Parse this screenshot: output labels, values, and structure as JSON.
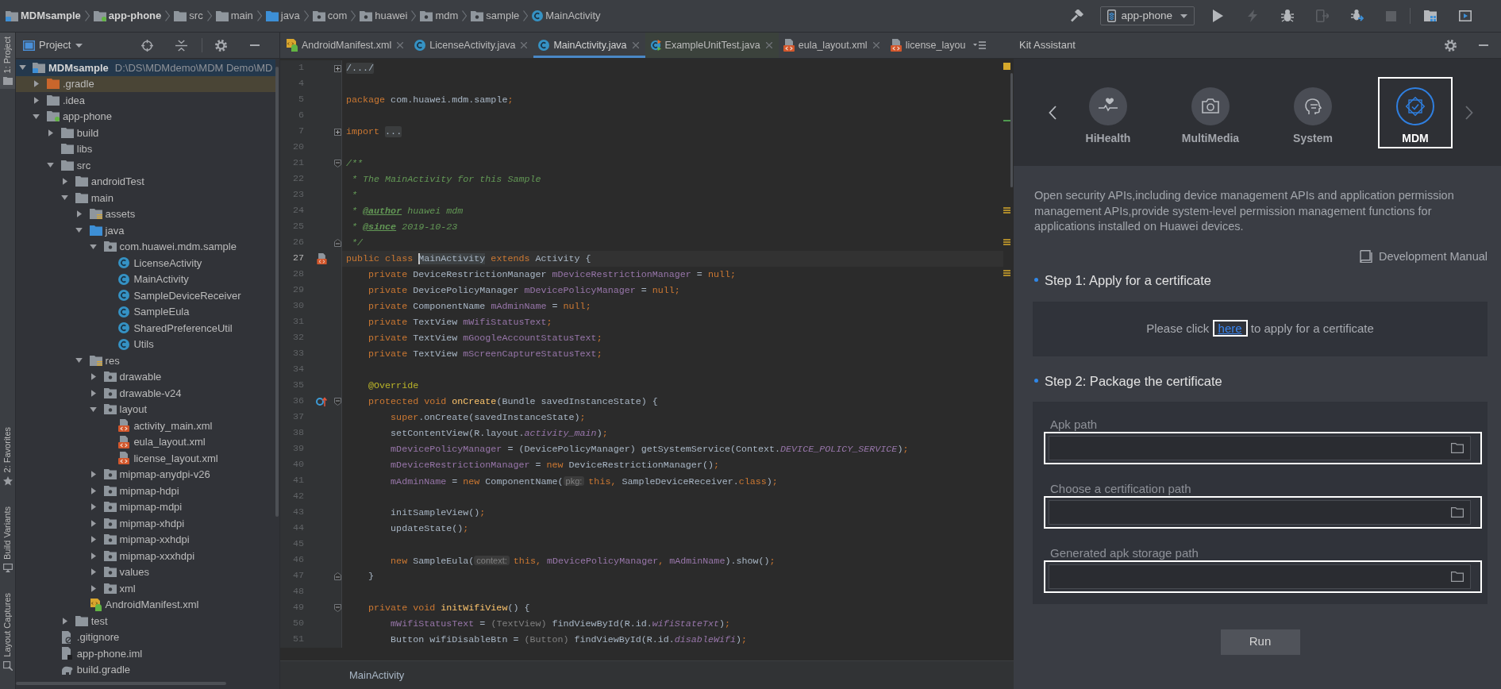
{
  "breadcrumb": [
    {
      "label": "MDMsample",
      "kind": "project_module"
    },
    {
      "label": "app-phone",
      "kind": "app_module"
    },
    {
      "label": "src",
      "kind": "folder"
    },
    {
      "label": "main",
      "kind": "folder"
    },
    {
      "label": "java",
      "kind": "source_folder"
    },
    {
      "label": "com",
      "kind": "package"
    },
    {
      "label": "huawei",
      "kind": "package"
    },
    {
      "label": "mdm",
      "kind": "package"
    },
    {
      "label": "sample",
      "kind": "package"
    },
    {
      "label": "MainActivity",
      "kind": "class"
    }
  ],
  "toolbar": [
    {
      "kind": "build",
      "disabled": false
    },
    {
      "kind": "run_config",
      "label": "app-phone"
    },
    {
      "kind": "run",
      "disabled": false
    },
    {
      "kind": "apply",
      "disabled": true
    },
    {
      "kind": "debug",
      "disabled": false
    },
    {
      "kind": "profile",
      "disabled": true
    },
    {
      "kind": "attach",
      "disabled": false
    },
    {
      "kind": "stop",
      "disabled": true
    },
    {
      "kind": "structure",
      "disabled": false
    },
    {
      "kind": "device",
      "disabled": false
    }
  ],
  "tool_stripe": [
    {
      "label": "1: Project",
      "kind": "project",
      "selected": true
    },
    {
      "label": "2: Favorites",
      "kind": "favorites",
      "selected": false
    },
    {
      "label": "Build Variants",
      "kind": "variants",
      "selected": false
    },
    {
      "label": "Layout Captures",
      "kind": "captures",
      "selected": false
    }
  ],
  "project_panel": {
    "view": "Project",
    "tree": [
      {
        "label": "MDMsample",
        "detail": "D:\\DS\\MDMdemo\\MDM Demo\\MD",
        "kind": "project_module",
        "expanded": true,
        "selected": true,
        "children": [
          {
            "label": ".gradle",
            "kind": "excluded_folder",
            "expanded": false,
            "selected": false
          },
          {
            "label": ".idea",
            "kind": "folder",
            "expanded": false,
            "selected": false
          },
          {
            "label": "app-phone",
            "kind": "app_module",
            "expanded": true,
            "selected": false,
            "children": [
              {
                "label": "build",
                "kind": "folder",
                "expanded": false,
                "selected": false
              },
              {
                "label": "libs",
                "kind": "folder",
                "selected": false
              },
              {
                "label": "src",
                "kind": "folder",
                "expanded": true,
                "selected": false,
                "children": [
                  {
                    "label": "androidTest",
                    "kind": "folder",
                    "expanded": false,
                    "selected": false
                  },
                  {
                    "label": "main",
                    "kind": "folder",
                    "expanded": true,
                    "selected": false,
                    "children": [
                      {
                        "label": "assets",
                        "kind": "resource_folder",
                        "expanded": false,
                        "selected": false
                      },
                      {
                        "label": "java",
                        "kind": "source_folder",
                        "expanded": true,
                        "selected": false,
                        "children": [
                          {
                            "label": "com.huawei.mdm.sample",
                            "kind": "package",
                            "expanded": true,
                            "selected": false,
                            "children": [
                              {
                                "label": "LicenseActivity",
                                "kind": "class",
                                "selected": false
                              },
                              {
                                "label": "MainActivity",
                                "kind": "class",
                                "selected": false
                              },
                              {
                                "label": "SampleDeviceReceiver",
                                "kind": "class",
                                "selected": false
                              },
                              {
                                "label": "SampleEula",
                                "kind": "class",
                                "selected": false
                              },
                              {
                                "label": "SharedPreferenceUtil",
                                "kind": "class",
                                "selected": false
                              },
                              {
                                "label": "Utils",
                                "kind": "class",
                                "selected": false
                              }
                            ]
                          }
                        ]
                      },
                      {
                        "label": "res",
                        "kind": "resource_folder",
                        "expanded": true,
                        "selected": false,
                        "children": [
                          {
                            "label": "drawable",
                            "kind": "package",
                            "expanded": false,
                            "selected": false
                          },
                          {
                            "label": "drawable-v24",
                            "kind": "package",
                            "expanded": false,
                            "selected": false
                          },
                          {
                            "label": "layout",
                            "kind": "package",
                            "expanded": true,
                            "selected": false,
                            "children": [
                              {
                                "label": "activity_main.xml",
                                "kind": "layout",
                                "selected": false
                              },
                              {
                                "label": "eula_layout.xml",
                                "kind": "layout",
                                "selected": false
                              },
                              {
                                "label": "license_layout.xml",
                                "kind": "layout",
                                "selected": false
                              }
                            ]
                          },
                          {
                            "label": "mipmap-anydpi-v26",
                            "kind": "package",
                            "expanded": false,
                            "selected": false
                          },
                          {
                            "label": "mipmap-hdpi",
                            "kind": "package",
                            "expanded": false,
                            "selected": false
                          },
                          {
                            "label": "mipmap-mdpi",
                            "kind": "package",
                            "expanded": false,
                            "selected": false
                          },
                          {
                            "label": "mipmap-xhdpi",
                            "kind": "package",
                            "expanded": false,
                            "selected": false
                          },
                          {
                            "label": "mipmap-xxhdpi",
                            "kind": "package",
                            "expanded": false,
                            "selected": false
                          },
                          {
                            "label": "mipmap-xxxhdpi",
                            "kind": "package",
                            "expanded": false,
                            "selected": false
                          },
                          {
                            "label": "values",
                            "kind": "package",
                            "expanded": false,
                            "selected": false
                          },
                          {
                            "label": "xml",
                            "kind": "package",
                            "expanded": false,
                            "selected": false
                          }
                        ]
                      },
                      {
                        "label": "AndroidManifest.xml",
                        "kind": "manifest",
                        "selected": false
                      }
                    ]
                  },
                  {
                    "label": "test",
                    "kind": "folder",
                    "expanded": false,
                    "selected": false
                  }
                ]
              },
              {
                "label": ".gitignore",
                "kind": "ignore_file",
                "selected": false
              },
              {
                "label": "app-phone.iml",
                "kind": "iml_file",
                "selected": false
              },
              {
                "label": "build.gradle",
                "kind": "gradle_file",
                "selected": false
              }
            ]
          }
        ]
      }
    ]
  },
  "editor": {
    "tabs": [
      {
        "label": "AndroidManifest.xml",
        "kind": "manifest",
        "selected": false,
        "closable": true
      },
      {
        "label": "LicenseActivity.java",
        "kind": "class",
        "selected": false,
        "closable": true
      },
      {
        "label": "MainActivity.java",
        "kind": "class",
        "selected": true,
        "closable": true
      },
      {
        "label": "ExampleUnitTest.java",
        "kind": "test_class",
        "selected": false,
        "closable": true
      },
      {
        "label": "eula_layout.xml",
        "kind": "layout",
        "selected": false,
        "closable": true
      },
      {
        "label": "license_layou",
        "kind": "layout",
        "selected": false,
        "closable": false
      }
    ],
    "lines": [
      {
        "number": "1",
        "fold": {
          "kind": "collapsed"
        },
        "current": false,
        "tokens": [
          {
            "text": "/.../",
            "kind": "fold"
          }
        ]
      },
      {
        "number": "4",
        "current": false
      },
      {
        "number": "5",
        "current": false,
        "tokens": [
          {
            "text": "package",
            "kind": "kw"
          },
          {
            "text": " com.huawei.mdm.sample",
            "kind": "plain"
          },
          {
            "text": ";",
            "kind": "punct"
          }
        ]
      },
      {
        "number": "6",
        "current": false
      },
      {
        "number": "7",
        "fold": {
          "kind": "collapsed"
        },
        "current": false,
        "tokens": [
          {
            "text": "import ",
            "kind": "kw"
          },
          {
            "text": "...",
            "kind": "fold"
          }
        ]
      },
      {
        "number": "20",
        "current": false
      },
      {
        "number": "21",
        "fold": {
          "kind": "start"
        },
        "current": false,
        "tokens": [
          {
            "text": "/**",
            "kind": "doc"
          }
        ]
      },
      {
        "number": "22",
        "current": false,
        "tokens": [
          {
            "text": " * The MainActivity for this Sample",
            "kind": "doc"
          }
        ]
      },
      {
        "number": "23",
        "current": false,
        "tokens": [
          {
            "text": " *",
            "kind": "doc"
          }
        ]
      },
      {
        "number": "24",
        "current": false,
        "tokens": [
          {
            "text": " * ",
            "kind": "doc"
          },
          {
            "text": "@author",
            "kind": "doctag"
          },
          {
            "text": " huawei mdm",
            "kind": "doc"
          }
        ]
      },
      {
        "number": "25",
        "current": false,
        "tokens": [
          {
            "text": " * ",
            "kind": "doc"
          },
          {
            "text": "@since",
            "kind": "doctag"
          },
          {
            "text": " 2019-10-23",
            "kind": "doc"
          }
        ]
      },
      {
        "number": "26",
        "fold": {
          "kind": "end"
        },
        "current": false,
        "tokens": [
          {
            "text": " */",
            "kind": "doc"
          }
        ]
      },
      {
        "number": "27",
        "gutter": {
          "kind": "layout"
        },
        "current": true,
        "tokens": [
          {
            "text": "public class ",
            "kind": "kw"
          },
          {
            "text": "MainActivity",
            "kind": "caret"
          },
          {
            "text": " extends ",
            "kind": "kw"
          },
          {
            "text": "Activity {",
            "kind": "plain"
          }
        ]
      },
      {
        "number": "28",
        "current": false,
        "tokens": [
          {
            "text": "    private ",
            "kind": "kw"
          },
          {
            "text": "DeviceRestrictionManager ",
            "kind": "plain"
          },
          {
            "text": "mDeviceRestrictionManager",
            "kind": "field"
          },
          {
            "text": " = ",
            "kind": "plain"
          },
          {
            "text": "null",
            "kind": "kw"
          },
          {
            "text": ";",
            "kind": "punct"
          }
        ]
      },
      {
        "number": "29",
        "current": false,
        "tokens": [
          {
            "text": "    private ",
            "kind": "kw"
          },
          {
            "text": "DevicePolicyManager ",
            "kind": "plain"
          },
          {
            "text": "mDevicePolicyManager",
            "kind": "field"
          },
          {
            "text": " = ",
            "kind": "plain"
          },
          {
            "text": "null",
            "kind": "kw"
          },
          {
            "text": ";",
            "kind": "punct"
          }
        ]
      },
      {
        "number": "30",
        "current": false,
        "tokens": [
          {
            "text": "    private ",
            "kind": "kw"
          },
          {
            "text": "ComponentName ",
            "kind": "plain"
          },
          {
            "text": "mAdminName",
            "kind": "field"
          },
          {
            "text": " = ",
            "kind": "plain"
          },
          {
            "text": "null",
            "kind": "kw"
          },
          {
            "text": ";",
            "kind": "punct"
          }
        ]
      },
      {
        "number": "31",
        "current": false,
        "tokens": [
          {
            "text": "    private ",
            "kind": "kw"
          },
          {
            "text": "TextView ",
            "kind": "plain"
          },
          {
            "text": "mWifiStatusText",
            "kind": "field"
          },
          {
            "text": ";",
            "kind": "punct"
          }
        ]
      },
      {
        "number": "32",
        "current": false,
        "tokens": [
          {
            "text": "    private ",
            "kind": "kw"
          },
          {
            "text": "TextView ",
            "kind": "plain"
          },
          {
            "text": "mGoogleAccountStatusText",
            "kind": "field"
          },
          {
            "text": ";",
            "kind": "punct"
          }
        ]
      },
      {
        "number": "33",
        "current": false,
        "tokens": [
          {
            "text": "    private ",
            "kind": "kw"
          },
          {
            "text": "TextView ",
            "kind": "plain"
          },
          {
            "text": "mScreenCaptureStatusText",
            "kind": "field"
          },
          {
            "text": ";",
            "kind": "punct"
          }
        ]
      },
      {
        "number": "34",
        "current": false
      },
      {
        "number": "35",
        "current": false,
        "tokens": [
          {
            "text": "    @Override",
            "kind": "annot"
          }
        ]
      },
      {
        "number": "36",
        "gutter": {
          "kind": "override"
        },
        "fold": {
          "kind": "start"
        },
        "current": false,
        "tokens": [
          {
            "text": "    protected void ",
            "kind": "kw"
          },
          {
            "text": "onCreate",
            "kind": "method"
          },
          {
            "text": "(Bundle savedInstanceState) {",
            "kind": "plain"
          }
        ]
      },
      {
        "number": "37",
        "current": false,
        "tokens": [
          {
            "text": "        super",
            "kind": "kw"
          },
          {
            "text": ".onCreate(savedInstanceState)",
            "kind": "plain"
          },
          {
            "text": ";",
            "kind": "punct"
          }
        ]
      },
      {
        "number": "38",
        "current": false,
        "tokens": [
          {
            "text": "        setContentView(R.layout.",
            "kind": "plain"
          },
          {
            "text": "activity_main",
            "kind": "static"
          },
          {
            "text": ")",
            "kind": "plain"
          },
          {
            "text": ";",
            "kind": "punct"
          }
        ]
      },
      {
        "number": "39",
        "current": false,
        "tokens": [
          {
            "text": "        mDevicePolicyManager",
            "kind": "field"
          },
          {
            "text": " = (DevicePolicyManager) getSystemService(Context.",
            "kind": "plain"
          },
          {
            "text": "DEVICE_POLICY_SERVICE",
            "kind": "static"
          },
          {
            "text": ")",
            "kind": "plain"
          },
          {
            "text": ";",
            "kind": "punct"
          }
        ]
      },
      {
        "number": "40",
        "current": false,
        "tokens": [
          {
            "text": "        mDeviceRestrictionManager",
            "kind": "field"
          },
          {
            "text": " = ",
            "kind": "plain"
          },
          {
            "text": "new ",
            "kind": "kw"
          },
          {
            "text": "DeviceRestrictionManager()",
            "kind": "plain"
          },
          {
            "text": ";",
            "kind": "punct"
          }
        ]
      },
      {
        "number": "41",
        "current": false,
        "tokens": [
          {
            "text": "        mAdminName",
            "kind": "field"
          },
          {
            "text": " = ",
            "kind": "plain"
          },
          {
            "text": "new ",
            "kind": "kw"
          },
          {
            "text": "ComponentName(",
            "kind": "plain"
          },
          {
            "text": "pkg:",
            "kind": "hint"
          },
          {
            "text": "this",
            "kind": "kw"
          },
          {
            "text": ", ",
            "kind": "punct"
          },
          {
            "text": "SampleDeviceReceiver.",
            "kind": "plain"
          },
          {
            "text": "class",
            "kind": "kw"
          },
          {
            "text": ")",
            "kind": "plain"
          },
          {
            "text": ";",
            "kind": "punct"
          }
        ]
      },
      {
        "number": "42",
        "current": false
      },
      {
        "number": "43",
        "current": false,
        "tokens": [
          {
            "text": "        initSampleView()",
            "kind": "plain"
          },
          {
            "text": ";",
            "kind": "punct"
          }
        ]
      },
      {
        "number": "44",
        "current": false,
        "tokens": [
          {
            "text": "        updateState()",
            "kind": "plain"
          },
          {
            "text": ";",
            "kind": "punct"
          }
        ]
      },
      {
        "number": "45",
        "current": false
      },
      {
        "number": "46",
        "current": false,
        "tokens": [
          {
            "text": "        new ",
            "kind": "kw"
          },
          {
            "text": "SampleEula(",
            "kind": "plain"
          },
          {
            "text": "context:",
            "kind": "hint"
          },
          {
            "text": "this",
            "kind": "kw"
          },
          {
            "text": ", ",
            "kind": "punct"
          },
          {
            "text": "mDevicePolicyManager",
            "kind": "field"
          },
          {
            "text": ", ",
            "kind": "punct"
          },
          {
            "text": "mAdminName",
            "kind": "field"
          },
          {
            "text": ").show()",
            "kind": "plain"
          },
          {
            "text": ";",
            "kind": "punct"
          }
        ]
      },
      {
        "number": "47",
        "fold": {
          "kind": "end"
        },
        "current": false,
        "tokens": [
          {
            "text": "    }",
            "kind": "plain"
          }
        ]
      },
      {
        "number": "48",
        "current": false
      },
      {
        "number": "49",
        "fold": {
          "kind": "start"
        },
        "current": false,
        "tokens": [
          {
            "text": "    private void ",
            "kind": "kw"
          },
          {
            "text": "initWifiView",
            "kind": "method"
          },
          {
            "text": "() {",
            "kind": "plain"
          }
        ]
      },
      {
        "number": "50",
        "current": false,
        "tokens": [
          {
            "text": "        mWifiStatusText",
            "kind": "field"
          },
          {
            "text": " = ",
            "kind": "plain"
          },
          {
            "text": "(TextView)",
            "kind": "cast"
          },
          {
            "text": " findViewById(R.id.",
            "kind": "plain"
          },
          {
            "text": "wifiStateTxt",
            "kind": "static"
          },
          {
            "text": ")",
            "kind": "plain"
          },
          {
            "text": ";",
            "kind": "punct"
          }
        ]
      },
      {
        "number": "51",
        "current": false,
        "tokens": [
          {
            "text": "        Button wifiDisableBtn = ",
            "kind": "plain"
          },
          {
            "text": "(Button)",
            "kind": "cast"
          },
          {
            "text": " findViewById(R.id.",
            "kind": "plain"
          },
          {
            "text": "disableWifi",
            "kind": "static"
          },
          {
            "text": ")",
            "kind": "plain"
          },
          {
            "text": ";",
            "kind": "punct"
          }
        ]
      }
    ],
    "structure_path": "MainActivity"
  },
  "kit_assistant": {
    "title": "Kit Assistant",
    "kits": [
      {
        "label": "HiHealth",
        "kind": "health",
        "selected": false
      },
      {
        "label": "MultiMedia",
        "kind": "media",
        "selected": false
      },
      {
        "label": "System",
        "kind": "system",
        "selected": false
      },
      {
        "label": "MDM",
        "kind": "mdm",
        "selected": true
      }
    ],
    "description": "Open security APIs,including device management APIs and application permission management APIs,provide system-level permission management functions for applications installed on Huawei devices.",
    "manual": "Development Manual",
    "steps": [
      {
        "kind": "link",
        "title": "Step 1: Apply for a certificate",
        "before": "Please click",
        "link": "here",
        "after": "to apply for a certificate",
        "highlighted": true
      },
      {
        "kind": "fields",
        "title": "Step 2: Package the certificate",
        "fields": [
          {
            "label": "Apk path",
            "highlighted": true
          },
          {
            "label": "Choose a certification path",
            "highlighted": true
          },
          {
            "label": "Generated apk storage path",
            "highlighted": true
          }
        ]
      }
    ],
    "run": "Run"
  }
}
